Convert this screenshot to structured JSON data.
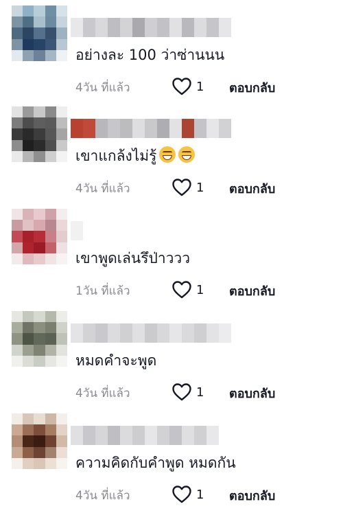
{
  "comments": [
    {
      "text": "อย่างละ 100 ว่าซ่านนน",
      "time": "4วัน ที่แล้ว",
      "likes": "1",
      "reply": "ตอบกลับ",
      "avatar_colors": [
        "#c9d6de",
        "#8fb0c6",
        "#b7cdd8",
        "#6e8fa4",
        "#d6e2e8",
        "#7d94a3",
        "#4f6f86",
        "#a9c0cc",
        "#6c8aa0",
        "#c8d4db",
        "#4d6a80",
        "#2c4563",
        "#54708a",
        "#38506b",
        "#9fb2bf",
        "#7d93a6",
        "#1f3a5e",
        "#264466",
        "#3a5575",
        "#b8c7d1",
        "#e3e9ed",
        "#8ea2b2",
        "#6d8299",
        "#a5b7c4",
        "#eef2f4"
      ],
      "name_colors": [
        "#e8e8ea",
        "#c9c9cd",
        "#d9d9dc",
        "#bdbdc2",
        "#d3d3d6",
        "#a9a9ae",
        "#cfcfd3",
        "#c2c2c6",
        "#e1e1e4",
        "#b8b8bd",
        "#dcdcdf",
        "#c6c6ca",
        "#e6e6e8"
      ],
      "has_emoji": false
    },
    {
      "text": "เขาแกล้งไม่รู้",
      "time": "4วัน ที่แล้ว",
      "likes": "1",
      "reply": "ตอบกลับ",
      "avatar_colors": [
        "#e2e2e2",
        "#9a9a9a",
        "#c8c8c8",
        "#8a8a8a",
        "#eeeeee",
        "#7c7c7c",
        "#4d4d4d",
        "#5e5e5e",
        "#5a5a5a",
        "#bdbdbd",
        "#3b3b3b",
        "#2a2a2a",
        "#3c3c3c",
        "#575757",
        "#a5a5a5",
        "#8d8d8d",
        "#1f1f1f",
        "#2b2b2b",
        "#4e4e4e",
        "#c9c9c9",
        "#eaeaea",
        "#b6b6b6",
        "#8f8f8f",
        "#cfcfcf",
        "#f3f3f3"
      ],
      "name_colors": [
        "#b8412f",
        "#c04a37",
        "#b8b8bc",
        "#c7c7cb",
        "#bcbcbf",
        "#dedee0",
        "#c9c9cc",
        "#aeaeb2",
        "#e2e2e4",
        "#ab4433",
        "#c4c4c8",
        "#e6e6e8",
        "#d2d2d5"
      ],
      "has_emoji": true
    },
    {
      "text": "เขาพูดเล่นรึป่าววว",
      "time": "1วัน ที่แล้ว",
      "likes": "1",
      "reply": "ตอบกลับ",
      "avatar_colors": [
        "#f0e4e6",
        "#d9b3b8",
        "#e8c9cd",
        "#cfa2a9",
        "#f5eced",
        "#c99aa1",
        "#e2c1c5",
        "#d7a9af",
        "#b9878f",
        "#ebd6d8",
        "#c24b55",
        "#a8202b",
        "#b52d38",
        "#c97f87",
        "#e4cbce",
        "#d3a6ab",
        "#b0232e",
        "#9a1b25",
        "#c46068",
        "#efe1e2",
        "#f3eaeb",
        "#deb9bd",
        "#e8cacd",
        "#f1e4e5",
        "#f8f3f3"
      ],
      "name_colors": [
        "#f1f1f2"
      ],
      "has_emoji": false
    },
    {
      "text": "หมดคำจะพูด",
      "time": "4วัน ที่แล้ว",
      "likes": "1",
      "reply": "ตอบกลับ",
      "avatar_colors": [
        "#e6e7e1",
        "#c5c8bd",
        "#d6d9cf",
        "#b5b9ab",
        "#ecede8",
        "#a9ad9d",
        "#6f7466",
        "#8a8f7e",
        "#7a7f70",
        "#cfd2c8",
        "#8f9482",
        "#4e5546",
        "#63695a",
        "#5c6253",
        "#bfc2b6",
        "#d1d4ca",
        "#9ca091",
        "#7e8374",
        "#b0b3a6",
        "#e2e3de",
        "#f0f1ed",
        "#dadcd5",
        "#c9ccc2",
        "#e6e7e2",
        "#f4f5f2"
      ],
      "name_colors": [
        "#e4e4e6",
        "#d3d3d6",
        "#c9c9cd",
        "#dcdcdf",
        "#d0d0d3",
        "#e0e0e2",
        "#cbcbce",
        "#d8d8db",
        "#e6e6e8",
        "#dadadd",
        "#cfcfd2",
        "#e3e3e5",
        "#ececee"
      ],
      "has_emoji": false
    },
    {
      "text": "ความคิดกับคำพูด หมดกัน",
      "time": "4วัน ที่แล้ว",
      "likes": "1",
      "reply": "ตอบกลับ",
      "avatar_colors": [
        "#f2ece6",
        "#d8c6b8",
        "#e8ddd3",
        "#cdb7a5",
        "#f4efea",
        "#caa892",
        "#9a6e57",
        "#7d4f3a",
        "#a67c63",
        "#e3d3c6",
        "#b38d74",
        "#4a2619",
        "#3b1c12",
        "#6e4332",
        "#d2baa8",
        "#c9ab95",
        "#8d6149",
        "#6d4433",
        "#a3826d",
        "#ebdfd5",
        "#f5f0eb",
        "#e1d0c2",
        "#d9c6b6",
        "#ecdfd4",
        "#f7f3ef"
      ],
      "name_colors": [
        "#e0e0e3",
        "#c8c8cc",
        "#d6d6d9",
        "#bfbfc3",
        "#dbdbde",
        "#cdcdd0",
        "#e6e6e8",
        "#d2d2d5",
        "#c4c4c8",
        "#dfdfe2",
        "#d0d0d3",
        "#e8e8ea"
      ],
      "has_emoji": false
    }
  ]
}
